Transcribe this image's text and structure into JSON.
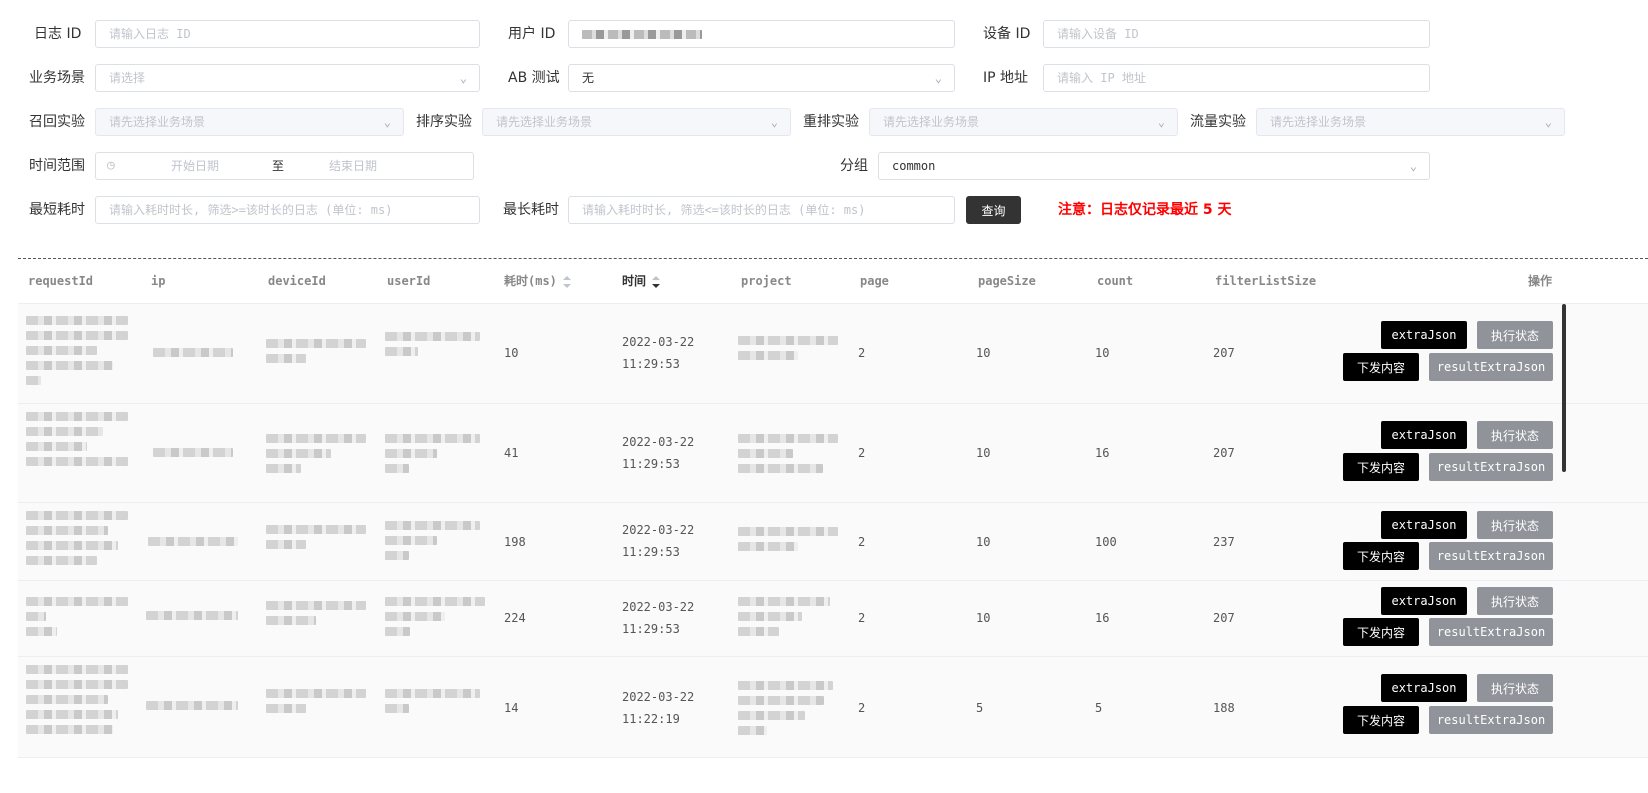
{
  "filters": {
    "log_id": {
      "label": "日志 ID",
      "placeholder": "请输入日志 ID"
    },
    "user_id": {
      "label": "用户 ID"
    },
    "device_id": {
      "label": "设备 ID",
      "placeholder": "请输入设备 ID"
    },
    "scene": {
      "label": "业务场景",
      "placeholder": "请选择"
    },
    "ab_test": {
      "label": "AB 测试",
      "value": "无"
    },
    "ip": {
      "label": "IP 地址",
      "placeholder": "请输入 IP 地址"
    },
    "recall": {
      "label": "召回实验",
      "placeholder": "请先选择业务场景"
    },
    "rank": {
      "label": "排序实验",
      "placeholder": "请先选择业务场景"
    },
    "rerank": {
      "label": "重排实验",
      "placeholder": "请先选择业务场景"
    },
    "traffic": {
      "label": "流量实验",
      "placeholder": "请先选择业务场景"
    },
    "time_range": {
      "label": "时间范围",
      "start_placeholder": "开始日期",
      "separator": "至",
      "end_placeholder": "结束日期"
    },
    "group": {
      "label": "分组",
      "value": "common"
    },
    "min_cost": {
      "label": "最短耗时",
      "placeholder": "请输入耗时时长, 筛选>=该时长的日志 (单位: ms)"
    },
    "max_cost": {
      "label": "最长耗时",
      "placeholder": "请输入耗时时长, 筛选<=该时长的日志 (单位: ms)"
    },
    "query_label": "查询",
    "notice": "注意：日志仅记录最近 5 天"
  },
  "table": {
    "columns": [
      "requestId",
      "ip",
      "deviceId",
      "userId",
      "耗时(ms)",
      "时间",
      "project",
      "page",
      "pageSize",
      "count",
      "filterListSize",
      "操作"
    ],
    "rows": [
      {
        "cost": "10",
        "time": "2022-03-22 11:29:53",
        "page": "2",
        "pageSize": "10",
        "count": "10",
        "filterListSize": "207"
      },
      {
        "cost": "41",
        "time": "2022-03-22 11:29:53",
        "page": "2",
        "pageSize": "10",
        "count": "16",
        "filterListSize": "207"
      },
      {
        "cost": "198",
        "time": "2022-03-22 11:29:53",
        "page": "2",
        "pageSize": "10",
        "count": "100",
        "filterListSize": "237"
      },
      {
        "cost": "224",
        "time": "2022-03-22 11:29:53",
        "page": "2",
        "pageSize": "10",
        "count": "16",
        "filterListSize": "207"
      },
      {
        "cost": "14",
        "time": "2022-03-22 11:22:19",
        "page": "2",
        "pageSize": "5",
        "count": "5",
        "filterListSize": "188"
      }
    ],
    "actions": {
      "extra_json": "extraJson",
      "exec_status": "执行状态",
      "issued_content": "下发内容",
      "result_extra_json": "resultExtraJson"
    }
  },
  "icons": {
    "select": "chevron-down-icon",
    "date": "clock-icon",
    "sort": "sort-caret-icon"
  },
  "colors": {
    "primary_button": "#333333",
    "action_black": "#000000",
    "action_grey": "#909399",
    "notice": "#ff0000"
  }
}
